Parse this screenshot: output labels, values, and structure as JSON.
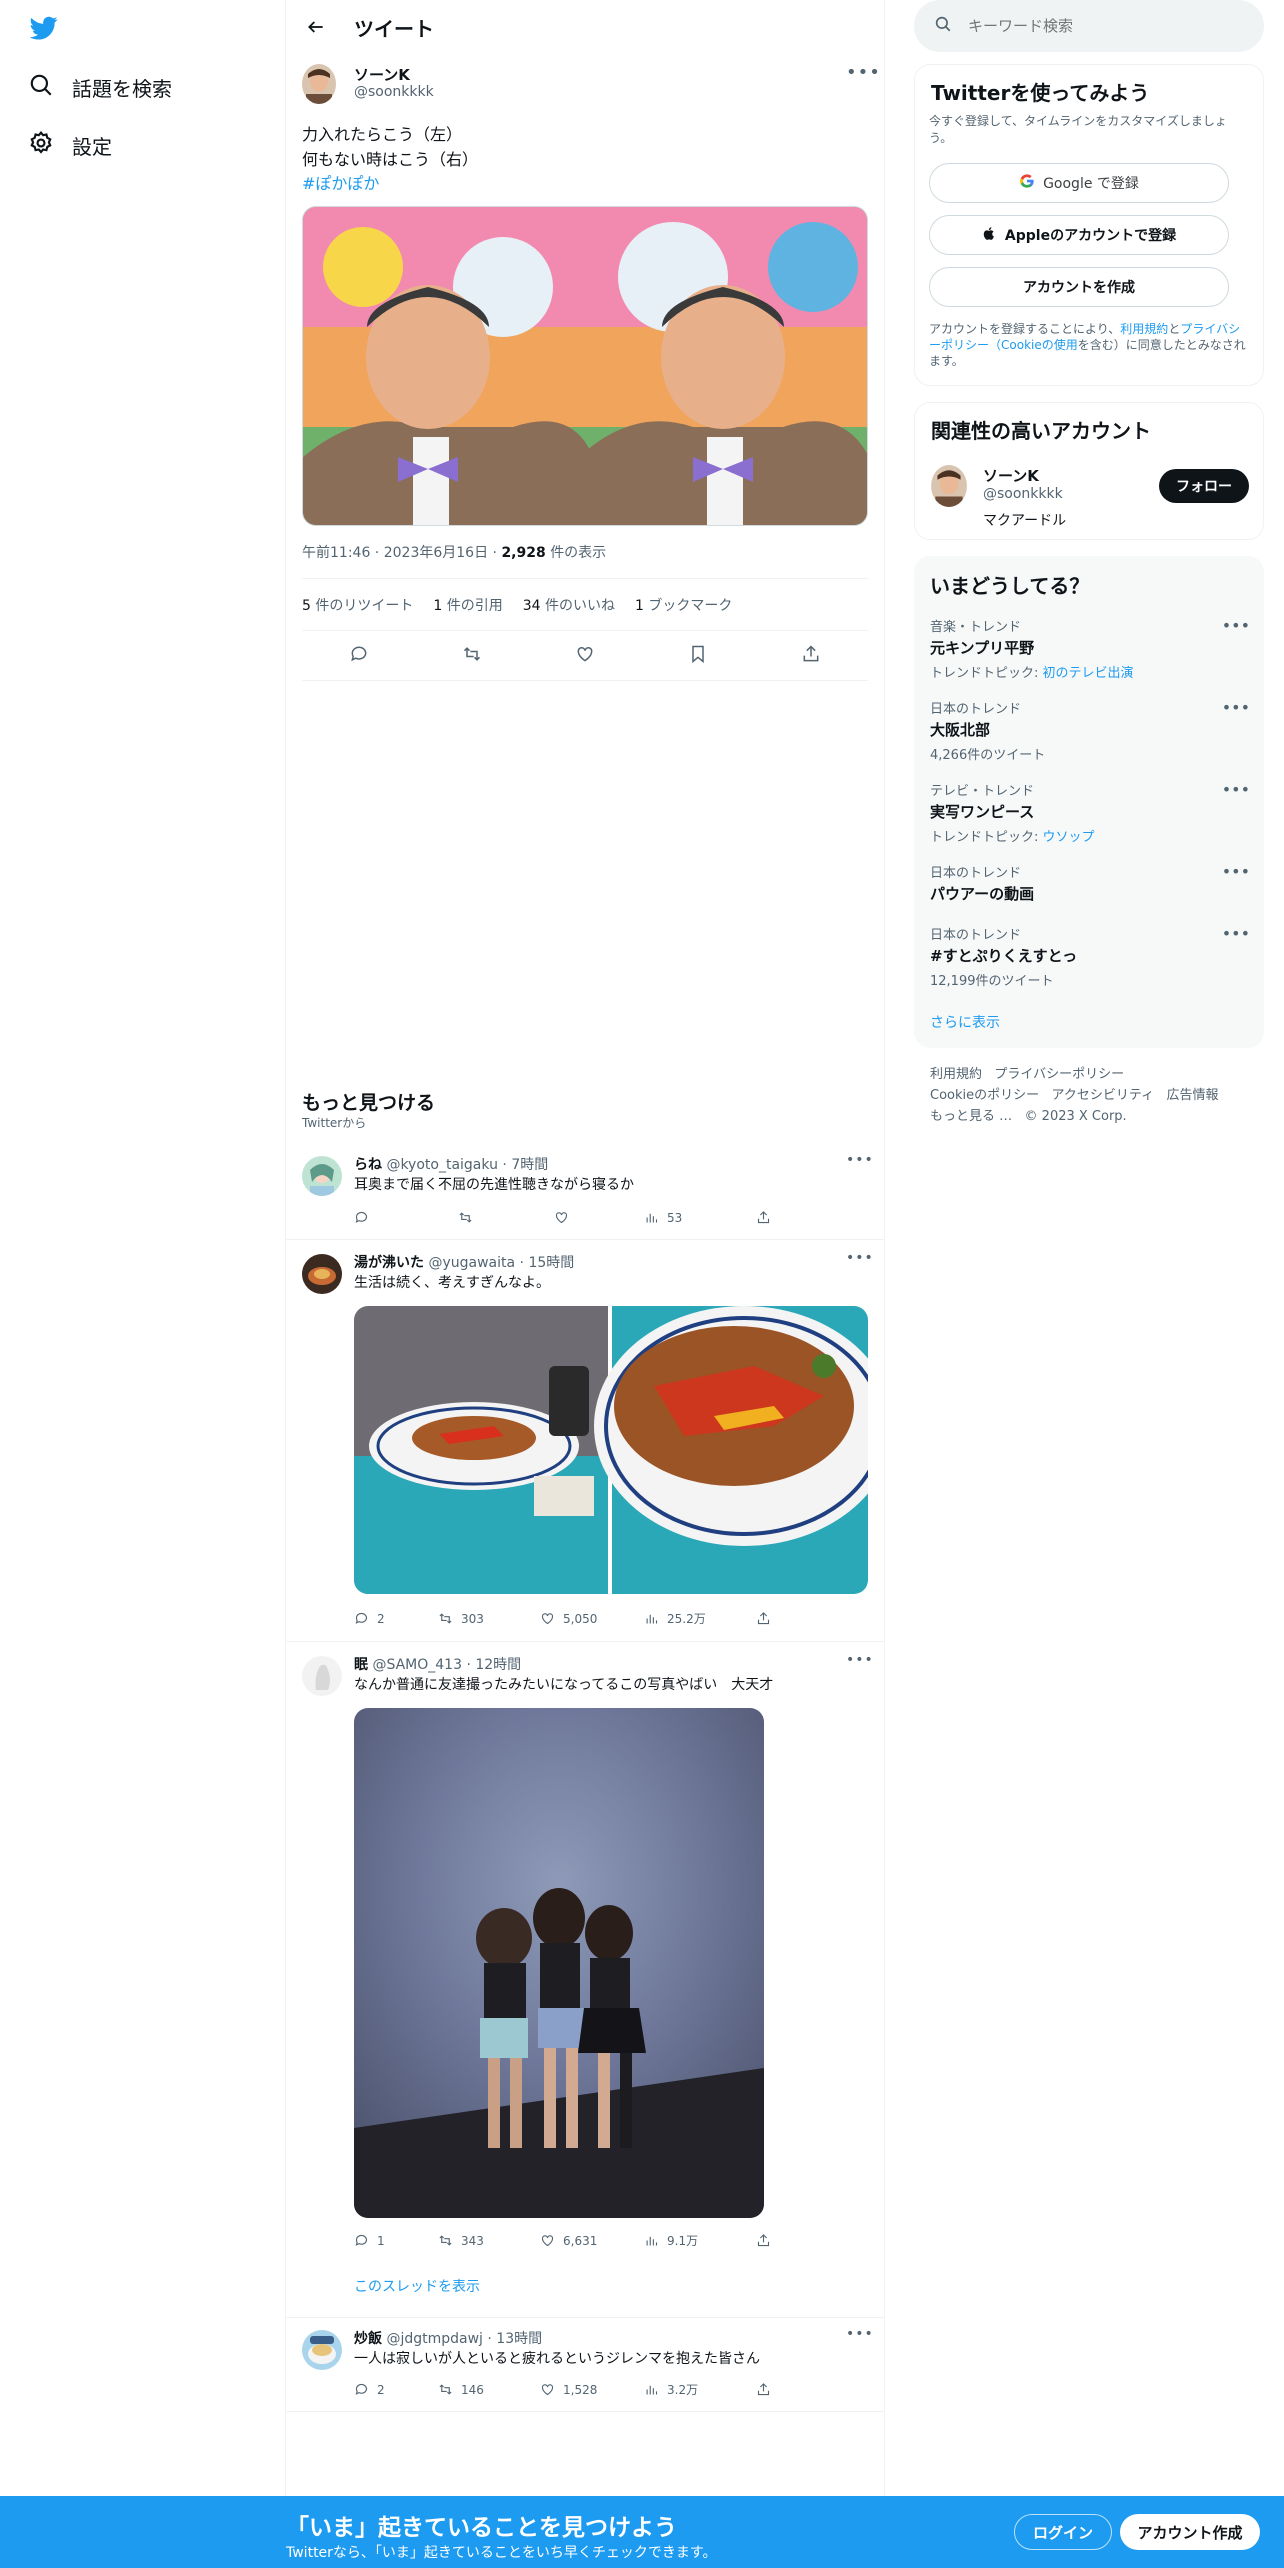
{
  "nav": {
    "explore_label": "話題を検索",
    "settings_label": "設定"
  },
  "header": {
    "title": "ツイート"
  },
  "tweet": {
    "author_name": "ソーンK",
    "author_handle": "@soonkkkk",
    "line1": "力入れたらこう（左）",
    "line2": "何もない時はこう（右）",
    "hashtag": "#ぽかぽか",
    "time": "午前11:46",
    "date": "2023年6月16日",
    "views_count": "2,928",
    "views_label": "件の表示",
    "retweets_count": "5",
    "retweets_label": "件のリツイート",
    "quotes_count": "1",
    "quotes_label": "件の引用",
    "likes_count": "34",
    "likes_label": "件のいいね",
    "bookmarks_count": "1",
    "bookmarks_label": "ブックマーク"
  },
  "discover": {
    "title": "もっと見つける",
    "subtitle": "Twitterから"
  },
  "feed": [
    {
      "name": "らね",
      "handle": "@kyoto_taigaku",
      "time": "7時間",
      "text": "耳奥まで届く不屈の先進性聴きながら寝るか",
      "replies": "",
      "retweets": "",
      "likes": "",
      "views": "53"
    },
    {
      "name": "湯が沸いた",
      "handle": "@yugawaita",
      "time": "15時間",
      "text": "生活は続く、考えすぎんなよ。",
      "replies": "2",
      "retweets": "303",
      "likes": "5,050",
      "views": "25.2万"
    },
    {
      "name": "眠",
      "handle": "@SAMO_413",
      "time": "12時間",
      "text": "なんか普通に友達撮ったみたいになってるこの写真やばい　大天才",
      "replies": "1",
      "retweets": "343",
      "likes": "6,631",
      "views": "9.1万",
      "thread_link": "このスレッドを表示"
    },
    {
      "name": "炒飯",
      "handle": "@jdgtmpdawj",
      "time": "13時間",
      "text": "一人は寂しいが人といると疲れるというジレンマを抱えた皆さん",
      "replies": "2",
      "retweets": "146",
      "likes": "1,528",
      "views": "3.2万"
    }
  ],
  "search": {
    "placeholder": "キーワード検索"
  },
  "signup": {
    "title": "Twitterを使ってみよう",
    "subtitle": "今すぐ登録して、タイムラインをカスタマイズしましょう。",
    "google_label": "Google で登録",
    "apple_label": "Appleのアカウントで登録",
    "create_label": "アカウントを作成",
    "legal_pre": "アカウントを登録することにより、",
    "legal_terms": "利用規約",
    "legal_and": "と",
    "legal_privacy": "プライバシーポリシー",
    "legal_cookie": "（Cookieの使用",
    "legal_post": "を含む）に同意したとみなされます。"
  },
  "related": {
    "title": "関連性の高いアカウント",
    "name": "ソーンK",
    "handle": "@soonkkkk",
    "bio": "マクアードル",
    "follow_label": "フォロー"
  },
  "trends": {
    "title": "いまどうしてる？",
    "items": [
      {
        "category": "音楽・トレンド",
        "title": "元キンプリ平野",
        "sub_prefix": "トレンドトピック: ",
        "sub_link": "初のテレビ出演",
        "sub": ""
      },
      {
        "category": "日本のトレンド",
        "title": "大阪北部",
        "sub_prefix": "",
        "sub_link": "",
        "sub": "4,266件のツイート"
      },
      {
        "category": "テレビ・トレンド",
        "title": "実写ワンピース",
        "sub_prefix": "トレンドトピック: ",
        "sub_link": "ウソップ",
        "sub": ""
      },
      {
        "category": "日本のトレンド",
        "title": "パウアーの動画",
        "sub_prefix": "",
        "sub_link": "",
        "sub": ""
      },
      {
        "category": "日本のトレンド",
        "title": "#すとぷりくえすとっ",
        "sub_prefix": "",
        "sub_link": "",
        "sub": "12,199件のツイート"
      }
    ],
    "show_more": "さらに表示"
  },
  "footer": {
    "terms": "利用規約",
    "privacy": "プライバシーポリシー",
    "cookie": "Cookieのポリシー",
    "accessibility": "アクセシビリティ",
    "ads": "広告情報",
    "more": "もっと見る …",
    "copyright": "© 2023 X Corp."
  },
  "banner": {
    "title": "「いま」起きていることを見つけよう",
    "subtitle": "Twitterなら、「いま」起きていることをいち早くチェックできます。",
    "login_label": "ログイン",
    "signup_label": "アカウント作成"
  },
  "colors": {
    "accent": "#1d9bf0",
    "text": "#0f1419",
    "muted": "#536471"
  }
}
